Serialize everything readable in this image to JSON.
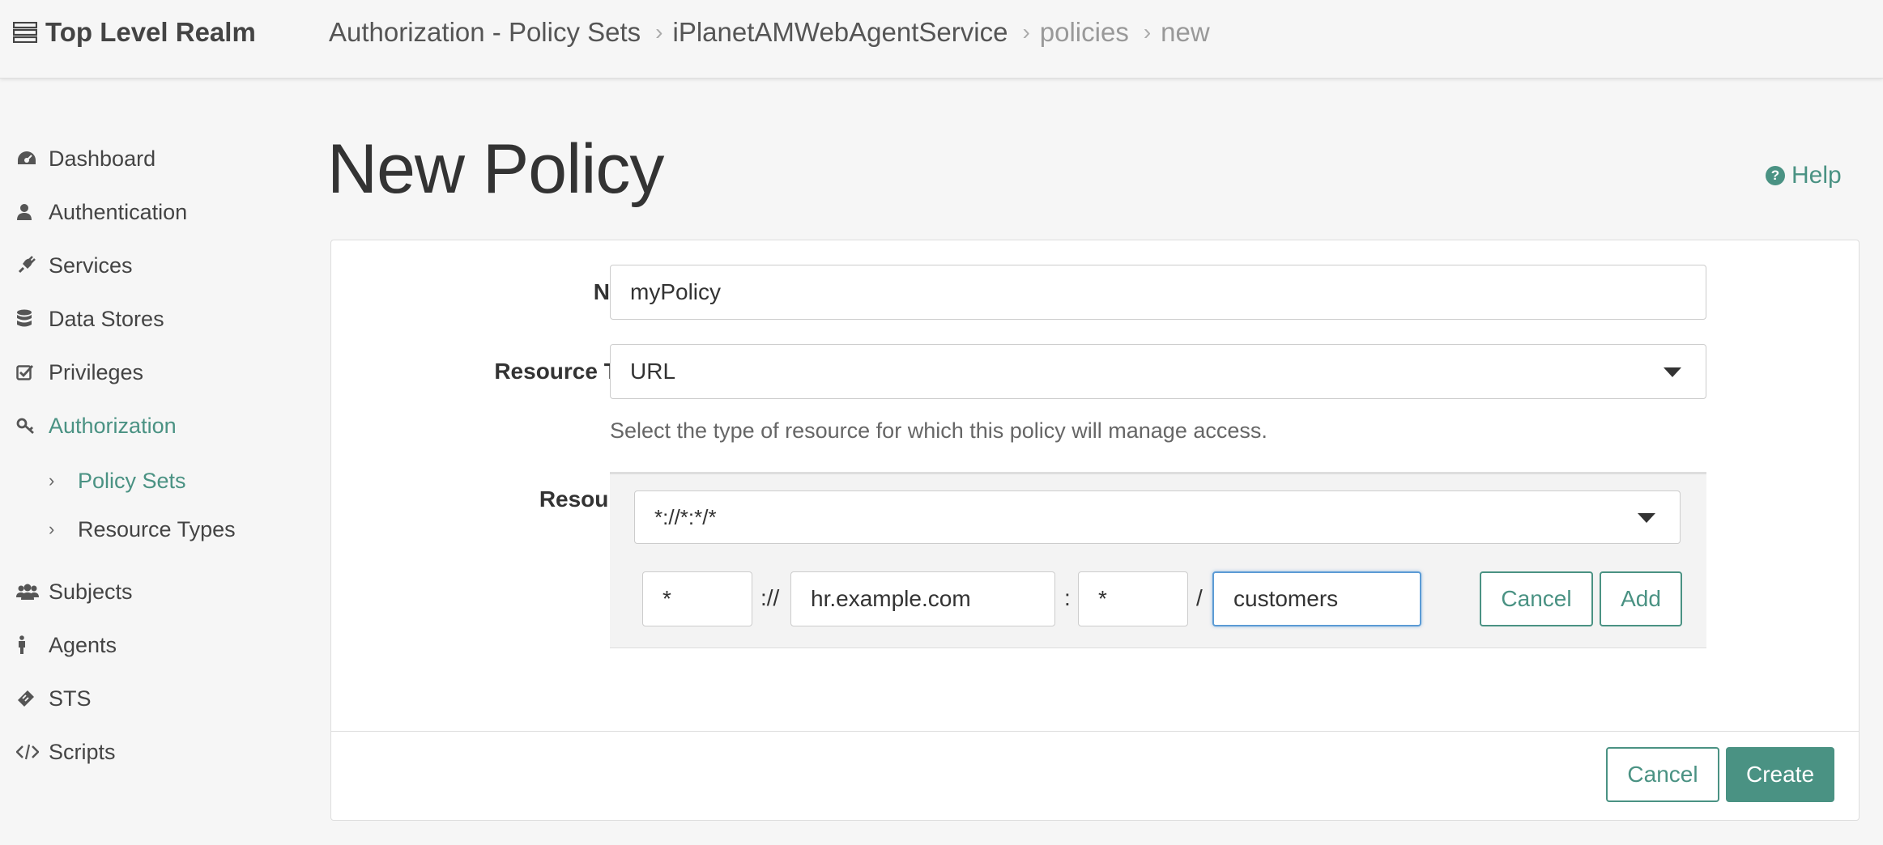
{
  "header": {
    "realm": "Top Level Realm",
    "breadcrumbs": [
      "Authorization - Policy Sets",
      "iPlanetAMWebAgentService",
      "policies",
      "new"
    ]
  },
  "sidebar": {
    "items": [
      {
        "label": "Dashboard",
        "icon": "dashboard-icon"
      },
      {
        "label": "Authentication",
        "icon": "user-icon"
      },
      {
        "label": "Services",
        "icon": "plug-icon"
      },
      {
        "label": "Data Stores",
        "icon": "database-icon"
      },
      {
        "label": "Privileges",
        "icon": "checkbox-icon"
      },
      {
        "label": "Authorization",
        "icon": "key-icon"
      },
      {
        "label": "Subjects",
        "icon": "users-icon"
      },
      {
        "label": "Agents",
        "icon": "person-icon"
      },
      {
        "label": "STS",
        "icon": "ticket-icon"
      },
      {
        "label": "Scripts",
        "icon": "code-icon"
      }
    ],
    "sub_items": [
      "Policy Sets",
      "Resource Types"
    ]
  },
  "page": {
    "title": "New Policy",
    "help": "Help"
  },
  "form": {
    "name_label": "Name",
    "name_value": "myPolicy",
    "resource_type_label": "Resource Type",
    "resource_type_value": "URL",
    "resource_type_help": "Select the type of resource for which this policy will manage access.",
    "resources_label": "Resources",
    "resource_pattern": "*://*:*/*",
    "scheme": "*",
    "scheme_sep": "://",
    "host": "hr.example.com",
    "port_sep": ":",
    "port": "*",
    "path_sep": "/",
    "path": "customers",
    "resource_cancel": "Cancel",
    "resource_add": "Add"
  },
  "footer": {
    "cancel": "Cancel",
    "create": "Create"
  },
  "colors": {
    "accent": "#4a9283"
  }
}
